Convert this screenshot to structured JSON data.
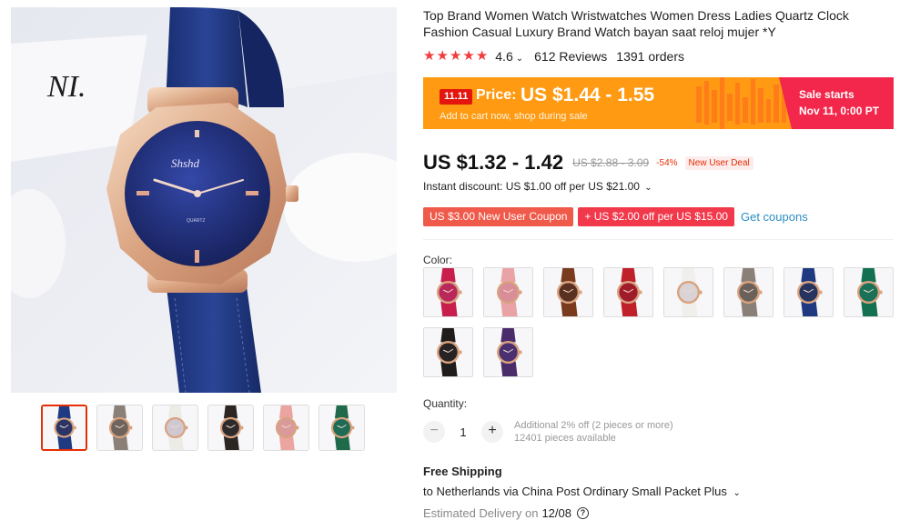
{
  "gallery": {
    "main_image": "blue-strap-watch",
    "backdrop_text": "NI.",
    "dial_brand": "Shshd",
    "dial_sub": "QUARTZ",
    "thumbnails": [
      {
        "name": "blue-watch-thumbnail",
        "strap": "#1f3a80",
        "dial": "#2a3566",
        "active": true
      },
      {
        "name": "grey-watch-thumbnail",
        "strap": "#8a8078",
        "dial": "#6f645d",
        "active": false
      },
      {
        "name": "white-watch-thumbnail",
        "strap": "#ecebe6",
        "dial": "#cfc8d3",
        "active": false
      },
      {
        "name": "black-watch-thumbnail",
        "strap": "#2b2622",
        "dial": "#2d2a2b",
        "active": false
      },
      {
        "name": "pink-watch-thumbnail",
        "strap": "#eba5a0",
        "dial": "#d99a9c",
        "active": false
      },
      {
        "name": "green-watch-thumbnail",
        "strap": "#1f6a4a",
        "dial": "#1e6c55",
        "active": false
      }
    ]
  },
  "product": {
    "title": "Top Brand Women Watch Wristwatches Women Dress Ladies Quartz Clock Fashion Casual Luxury Brand Watch bayan saat reloj mujer *Y",
    "rating": "4.6",
    "reviews": "612 Reviews",
    "orders": "1391 orders"
  },
  "sale": {
    "tag": "11.11",
    "price_label": "Price:",
    "price": "US $1.44 - 1.55",
    "subtitle": "Add to cart now, shop during sale",
    "starts_label": "Sale starts",
    "starts_date": "Nov 11, 0:00 PT"
  },
  "price": {
    "current": "US $1.32 - 1.42",
    "original": "US $2.88 - 3.09",
    "discount": "-54%",
    "deal_badge": "New User Deal"
  },
  "instant_discount": "Instant discount: US $1.00 off per US $21.00",
  "coupons": {
    "items": [
      "US $3.00 New User Coupon",
      "+ US $2.00 off per US $15.00"
    ],
    "link": "Get coupons"
  },
  "color": {
    "label": "Color:",
    "options": [
      {
        "name": "color-option-rose-red",
        "strap": "#c71e4d",
        "dial": "#b8285a"
      },
      {
        "name": "color-option-pink",
        "strap": "#e9a3a6",
        "dial": "#d88d98"
      },
      {
        "name": "color-option-brown",
        "strap": "#7a3a1d",
        "dial": "#5a3020"
      },
      {
        "name": "color-option-red",
        "strap": "#c0202a",
        "dial": "#a01c2a"
      },
      {
        "name": "color-option-white",
        "strap": "#f1efec",
        "dial": "#d9d3d6"
      },
      {
        "name": "color-option-grey",
        "strap": "#8a8078",
        "dial": "#6a615a"
      },
      {
        "name": "color-option-blue",
        "strap": "#1f3a80",
        "dial": "#26345f"
      },
      {
        "name": "color-option-green",
        "strap": "#137050",
        "dial": "#1a7158"
      },
      {
        "name": "color-option-black",
        "strap": "#1f1c1b",
        "dial": "#272324"
      },
      {
        "name": "color-option-purple",
        "strap": "#4b2c6b",
        "dial": "#4a3070"
      }
    ]
  },
  "quantity": {
    "label": "Quantity:",
    "value": "1",
    "minus": "−",
    "plus": "+",
    "note_discount": "Additional 2% off (2 pieces or more)",
    "note_available": "12401 pieces available"
  },
  "shipping": {
    "title": "Free Shipping",
    "destination": "to Netherlands via China Post Ordinary Small Packet Plus",
    "delivery_label": "Estimated Delivery on",
    "delivery_date": "12/08",
    "help_glyph": "?"
  },
  "colors": {
    "accent": "#e62e04",
    "sale_orange": "#ff9a12",
    "sale_red": "#f2274b",
    "star": "#f03c3c",
    "link": "#2b8ec4"
  }
}
